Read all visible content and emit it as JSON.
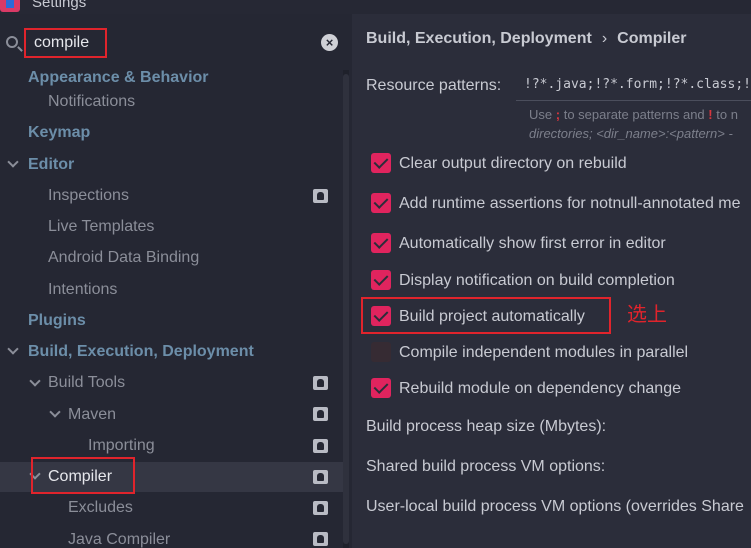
{
  "window": {
    "title": "Settings"
  },
  "search": {
    "value": "compile"
  },
  "tree": {
    "appearance": "Appearance & Behavior",
    "notifications": "Notifications",
    "keymap": "Keymap",
    "editor": "Editor",
    "inspections": "Inspections",
    "live_templates": "Live Templates",
    "android_data_binding": "Android Data Binding",
    "intentions": "Intentions",
    "plugins": "Plugins",
    "build_exec_deploy": "Build, Execution, Deployment",
    "build_tools": "Build Tools",
    "maven": "Maven",
    "importing": "Importing",
    "compiler": "Compiler",
    "excludes": "Excludes",
    "java_compiler": "Java Compiler"
  },
  "breadcrumb": {
    "section": "Build, Execution, Deployment",
    "separator": "›",
    "page": "Compiler"
  },
  "resource_patterns": {
    "label": "Resource patterns:",
    "value": "!?*.java;!?*.form;!?*.class;!",
    "hint_line1_a": "Use",
    "hint_sep_symbol": ";",
    "hint_line1_b": "to separate patterns and",
    "hint_neg_symbol": "!",
    "hint_line1_c": "to n",
    "hint_line2": "directories;  <dir_name>:<pattern> -"
  },
  "options": [
    {
      "label": "Clear output directory on rebuild",
      "checked": true
    },
    {
      "label": "Add runtime assertions for notnull-annotated me",
      "checked": true
    },
    {
      "label": "Automatically show first error in editor",
      "checked": true
    },
    {
      "label": "Display notification on build completion",
      "checked": true
    },
    {
      "label": "Build project automatically",
      "checked": true
    },
    {
      "label": "Compile independent modules in parallel",
      "checked": false
    },
    {
      "label": "Rebuild module on dependency change",
      "checked": true
    }
  ],
  "fields": {
    "heap_size": "Build process heap size (Mbytes):",
    "shared_vm": "Shared build process VM options:",
    "user_local_vm": "User-local build process VM options (overrides Share"
  },
  "annotation": "选上",
  "colors": {
    "accent_checkbox": "#e0245e",
    "highlight_box": "#e0242c",
    "section_heading": "#6c8ea9"
  }
}
